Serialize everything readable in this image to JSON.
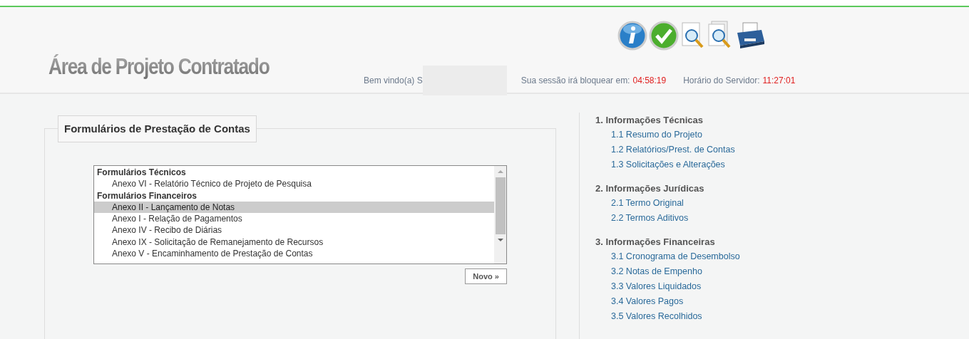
{
  "header": {
    "title": "Área de Projeto Contratado",
    "welcome": "Bem vindo(a) S",
    "session_label": "Sua sessão irá bloquear em:",
    "session_time": "04:58:19",
    "server_label": "Horário do Servidor:",
    "server_time": "11:27:01"
  },
  "forms_panel": {
    "legend": "Formulários de Prestação de Contas",
    "groups": [
      {
        "label": "Formulários Técnicos",
        "items": [
          {
            "label": "Anexo VI - Relatório Técnico de Projeto de Pesquisa",
            "selected": false
          }
        ]
      },
      {
        "label": "Formulários Financeiros",
        "items": [
          {
            "label": "Anexo II - Lançamento de Notas",
            "selected": true
          },
          {
            "label": "Anexo I - Relação de Pagamentos",
            "selected": false
          },
          {
            "label": "Anexo IV - Recibo de Diárias",
            "selected": false
          },
          {
            "label": "Anexo IX - Solicitação de Remanejamento de Recursos",
            "selected": false
          },
          {
            "label": "Anexo V - Encaminhamento de Prestação de Contas",
            "selected": false
          }
        ]
      }
    ],
    "new_button": "Novo »"
  },
  "menu": [
    {
      "title": "1. Informações Técnicas",
      "links": [
        "1.1 Resumo do Projeto",
        "1.2 Relatórios/Prest. de Contas",
        "1.3 Solicitações e Alterações"
      ]
    },
    {
      "title": "2. Informações Jurídicas",
      "links": [
        "2.1 Termo Original",
        "2.2 Termos Aditivos"
      ]
    },
    {
      "title": "3. Informações Financeiras",
      "links": [
        "3.1 Cronograma de Desembolso",
        "3.2 Notas de Empenho",
        "3.3 Valores Liquidados",
        "3.4 Valores Pagos",
        "3.5 Valores Recolhidos"
      ]
    }
  ]
}
